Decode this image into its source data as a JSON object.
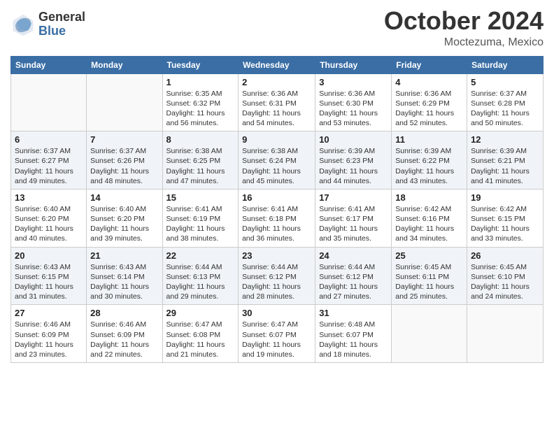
{
  "logo": {
    "general": "General",
    "blue": "Blue"
  },
  "header": {
    "month": "October 2024",
    "location": "Moctezuma, Mexico"
  },
  "weekdays": [
    "Sunday",
    "Monday",
    "Tuesday",
    "Wednesday",
    "Thursday",
    "Friday",
    "Saturday"
  ],
  "weeks": [
    [
      {
        "day": "",
        "info": ""
      },
      {
        "day": "",
        "info": ""
      },
      {
        "day": "1",
        "info": "Sunrise: 6:35 AM\nSunset: 6:32 PM\nDaylight: 11 hours and 56 minutes."
      },
      {
        "day": "2",
        "info": "Sunrise: 6:36 AM\nSunset: 6:31 PM\nDaylight: 11 hours and 54 minutes."
      },
      {
        "day": "3",
        "info": "Sunrise: 6:36 AM\nSunset: 6:30 PM\nDaylight: 11 hours and 53 minutes."
      },
      {
        "day": "4",
        "info": "Sunrise: 6:36 AM\nSunset: 6:29 PM\nDaylight: 11 hours and 52 minutes."
      },
      {
        "day": "5",
        "info": "Sunrise: 6:37 AM\nSunset: 6:28 PM\nDaylight: 11 hours and 50 minutes."
      }
    ],
    [
      {
        "day": "6",
        "info": "Sunrise: 6:37 AM\nSunset: 6:27 PM\nDaylight: 11 hours and 49 minutes."
      },
      {
        "day": "7",
        "info": "Sunrise: 6:37 AM\nSunset: 6:26 PM\nDaylight: 11 hours and 48 minutes."
      },
      {
        "day": "8",
        "info": "Sunrise: 6:38 AM\nSunset: 6:25 PM\nDaylight: 11 hours and 47 minutes."
      },
      {
        "day": "9",
        "info": "Sunrise: 6:38 AM\nSunset: 6:24 PM\nDaylight: 11 hours and 45 minutes."
      },
      {
        "day": "10",
        "info": "Sunrise: 6:39 AM\nSunset: 6:23 PM\nDaylight: 11 hours and 44 minutes."
      },
      {
        "day": "11",
        "info": "Sunrise: 6:39 AM\nSunset: 6:22 PM\nDaylight: 11 hours and 43 minutes."
      },
      {
        "day": "12",
        "info": "Sunrise: 6:39 AM\nSunset: 6:21 PM\nDaylight: 11 hours and 41 minutes."
      }
    ],
    [
      {
        "day": "13",
        "info": "Sunrise: 6:40 AM\nSunset: 6:20 PM\nDaylight: 11 hours and 40 minutes."
      },
      {
        "day": "14",
        "info": "Sunrise: 6:40 AM\nSunset: 6:20 PM\nDaylight: 11 hours and 39 minutes."
      },
      {
        "day": "15",
        "info": "Sunrise: 6:41 AM\nSunset: 6:19 PM\nDaylight: 11 hours and 38 minutes."
      },
      {
        "day": "16",
        "info": "Sunrise: 6:41 AM\nSunset: 6:18 PM\nDaylight: 11 hours and 36 minutes."
      },
      {
        "day": "17",
        "info": "Sunrise: 6:41 AM\nSunset: 6:17 PM\nDaylight: 11 hours and 35 minutes."
      },
      {
        "day": "18",
        "info": "Sunrise: 6:42 AM\nSunset: 6:16 PM\nDaylight: 11 hours and 34 minutes."
      },
      {
        "day": "19",
        "info": "Sunrise: 6:42 AM\nSunset: 6:15 PM\nDaylight: 11 hours and 33 minutes."
      }
    ],
    [
      {
        "day": "20",
        "info": "Sunrise: 6:43 AM\nSunset: 6:15 PM\nDaylight: 11 hours and 31 minutes."
      },
      {
        "day": "21",
        "info": "Sunrise: 6:43 AM\nSunset: 6:14 PM\nDaylight: 11 hours and 30 minutes."
      },
      {
        "day": "22",
        "info": "Sunrise: 6:44 AM\nSunset: 6:13 PM\nDaylight: 11 hours and 29 minutes."
      },
      {
        "day": "23",
        "info": "Sunrise: 6:44 AM\nSunset: 6:12 PM\nDaylight: 11 hours and 28 minutes."
      },
      {
        "day": "24",
        "info": "Sunrise: 6:44 AM\nSunset: 6:12 PM\nDaylight: 11 hours and 27 minutes."
      },
      {
        "day": "25",
        "info": "Sunrise: 6:45 AM\nSunset: 6:11 PM\nDaylight: 11 hours and 25 minutes."
      },
      {
        "day": "26",
        "info": "Sunrise: 6:45 AM\nSunset: 6:10 PM\nDaylight: 11 hours and 24 minutes."
      }
    ],
    [
      {
        "day": "27",
        "info": "Sunrise: 6:46 AM\nSunset: 6:09 PM\nDaylight: 11 hours and 23 minutes."
      },
      {
        "day": "28",
        "info": "Sunrise: 6:46 AM\nSunset: 6:09 PM\nDaylight: 11 hours and 22 minutes."
      },
      {
        "day": "29",
        "info": "Sunrise: 6:47 AM\nSunset: 6:08 PM\nDaylight: 11 hours and 21 minutes."
      },
      {
        "day": "30",
        "info": "Sunrise: 6:47 AM\nSunset: 6:07 PM\nDaylight: 11 hours and 19 minutes."
      },
      {
        "day": "31",
        "info": "Sunrise: 6:48 AM\nSunset: 6:07 PM\nDaylight: 11 hours and 18 minutes."
      },
      {
        "day": "",
        "info": ""
      },
      {
        "day": "",
        "info": ""
      }
    ]
  ]
}
